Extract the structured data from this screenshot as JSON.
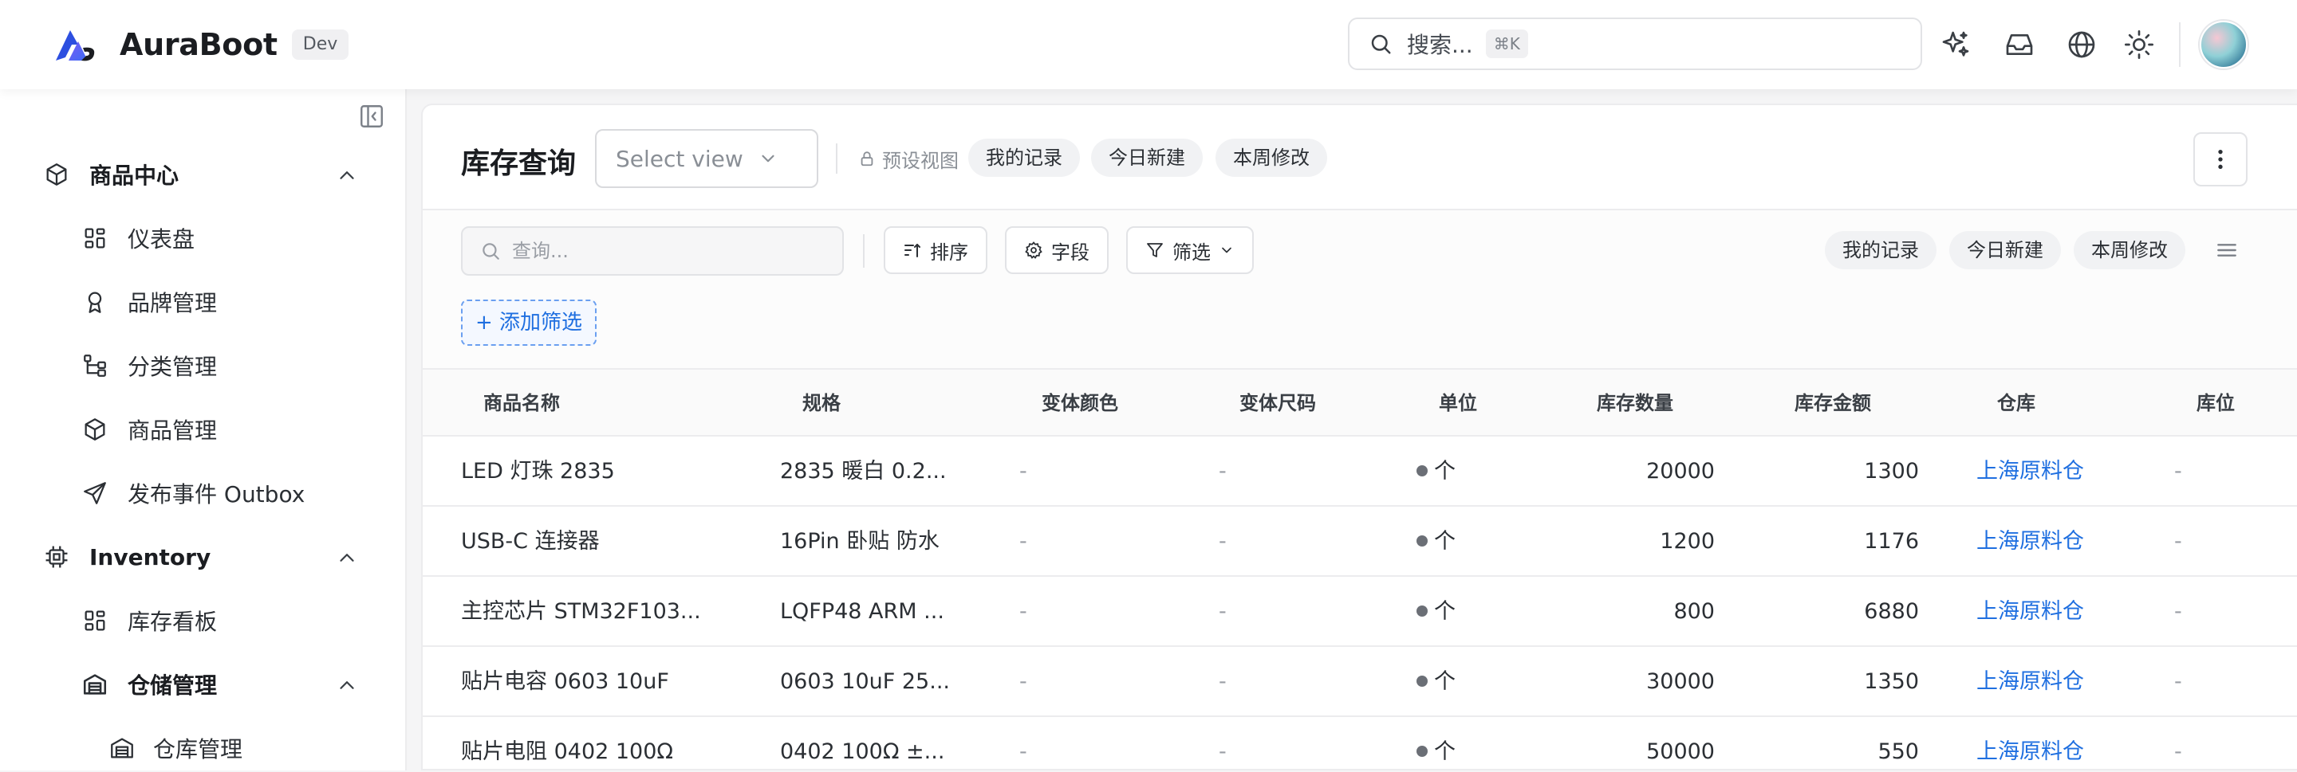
{
  "app": {
    "brand_name": "AuraBoot",
    "env_badge": "Dev",
    "search_placeholder": "搜索...",
    "search_shortcut": "⌘K",
    "top_icons": [
      "sparkles-icon",
      "inbox-icon",
      "globe-icon",
      "sun-icon"
    ]
  },
  "sidebar": {
    "groups": [
      {
        "label": "商品中心",
        "icon": "package-icon",
        "items": [
          {
            "label": "仪表盘",
            "icon": "dashboard-icon"
          },
          {
            "label": "品牌管理",
            "icon": "award-icon"
          },
          {
            "label": "分类管理",
            "icon": "tree-icon"
          },
          {
            "label": "商品管理",
            "icon": "package-icon"
          },
          {
            "label": "发布事件 Outbox",
            "icon": "send-icon"
          }
        ]
      },
      {
        "label": "Inventory",
        "icon": "chip-icon",
        "items": [
          {
            "label": "库存看板",
            "icon": "dashboard-icon"
          },
          {
            "label": "仓储管理",
            "icon": "warehouse-icon",
            "sub": [
              {
                "label": "仓库管理",
                "icon": "warehouse-icon"
              }
            ]
          }
        ]
      }
    ]
  },
  "page": {
    "title": "库存查询",
    "view_select_placeholder": "Select view",
    "preset_label": "预设视图",
    "preset_chips": [
      "我的记录",
      "今日新建",
      "本周修改"
    ],
    "query_placeholder": "查询...",
    "toolbar_buttons": {
      "sort": "排序",
      "fields": "字段",
      "filter": "筛选"
    },
    "quick_chips": [
      "我的记录",
      "今日新建",
      "本周修改"
    ],
    "add_filter": "+ 添加筛选"
  },
  "table": {
    "columns": [
      "商品名称",
      "规格",
      "变体颜色",
      "变体尺码",
      "单位",
      "库存数量",
      "库存金额",
      "仓库",
      "库位"
    ],
    "rows": [
      {
        "name": "LED 灯珠 2835",
        "spec": "2835 暖白 0.2...",
        "color": "-",
        "size": "-",
        "unit": "个",
        "qty": "20000",
        "amount": "1300",
        "warehouse": "上海原料仓",
        "location": "-"
      },
      {
        "name": "USB-C 连接器",
        "spec": "16Pin 卧贴 防水",
        "color": "-",
        "size": "-",
        "unit": "个",
        "qty": "1200",
        "amount": "1176",
        "warehouse": "上海原料仓",
        "location": "-"
      },
      {
        "name": "主控芯片 STM32F103...",
        "spec": "LQFP48 ARM ...",
        "color": "-",
        "size": "-",
        "unit": "个",
        "qty": "800",
        "amount": "6880",
        "warehouse": "上海原料仓",
        "location": "-"
      },
      {
        "name": "贴片电容 0603 10uF",
        "spec": "0603 10uF 25...",
        "color": "-",
        "size": "-",
        "unit": "个",
        "qty": "30000",
        "amount": "1350",
        "warehouse": "上海原料仓",
        "location": "-"
      },
      {
        "name": "贴片电阻 0402 100Ω",
        "spec": "0402 100Ω ±...",
        "color": "-",
        "size": "-",
        "unit": "个",
        "qty": "50000",
        "amount": "550",
        "warehouse": "上海原料仓",
        "location": "-"
      }
    ]
  },
  "colors": {
    "link": "#1f6fe0",
    "accent_logo_a": "#3b6cf6",
    "accent_logo_b": "#8b5cf6"
  }
}
